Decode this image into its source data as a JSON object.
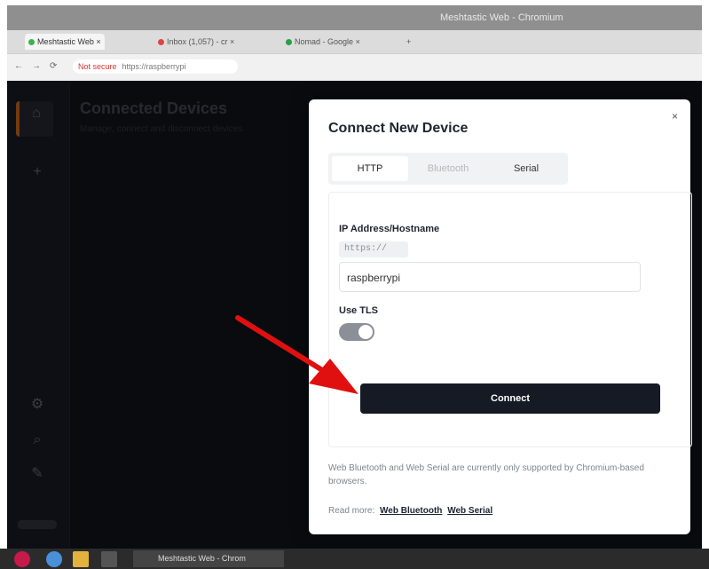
{
  "window": {
    "title": "Meshtastic Web - Chromium"
  },
  "browser": {
    "tabs": [
      {
        "label": "Meshtastic Web",
        "icon": "meshtastic-icon"
      },
      {
        "label": "Inbox (1,057) - cr",
        "icon": "gmail-icon"
      },
      {
        "label": "Nomad - Google",
        "icon": "drive-icon"
      }
    ],
    "new_tab_label": "+",
    "back": "←",
    "forward": "→",
    "reload": "⟳",
    "security_label": "Not secure",
    "url": "https://raspberrypi"
  },
  "background": {
    "heading": "Connected Devices",
    "subheading": "Manage, connect and disconnect devices"
  },
  "dialog": {
    "title": "Connect New Device",
    "close": "×",
    "tabs": [
      {
        "label": "HTTP"
      },
      {
        "label": "Bluetooth"
      },
      {
        "label": "Serial"
      }
    ],
    "ip_label": "IP Address/Hostname",
    "prefix": "https://",
    "input_value": "raspberrypi",
    "tls_label": "Use TLS",
    "tls_on": true,
    "connect_label": "Connect",
    "note": "Web Bluetooth and Web Serial are currently only supported by Chromium-based browsers.",
    "read_more": "Read more:",
    "link_bluetooth": "Web Bluetooth",
    "link_serial": "Web Serial"
  },
  "taskbar": {
    "task_label": "Meshtastic Web - Chrom"
  },
  "colors": {
    "accent": "#b35a16",
    "connect_bg": "#151a24",
    "annotation_arrow": "#e01010"
  }
}
